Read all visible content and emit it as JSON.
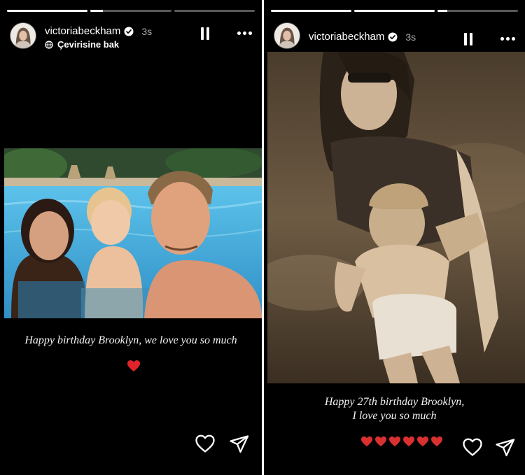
{
  "left_story": {
    "progress": [
      1,
      0.15,
      0
    ],
    "username": "victoriabeckham",
    "time": "3s",
    "translate_label": "Çevirisine bak",
    "caption": "Happy birthday Brooklyn, we love you so much",
    "icons": {
      "verified": "verified-badge-icon",
      "translate": "translate-icon",
      "pause": "pause-icon",
      "more": "more-icon",
      "like": "heart-outline-icon",
      "share": "send-icon",
      "emoji": "red-heart-emoji"
    },
    "heart_color": "#e0242b"
  },
  "right_story": {
    "progress": [
      1,
      1,
      0.12
    ],
    "username": "victoriabeckham",
    "time": "3s",
    "caption_line1": "Happy 27th birthday Brooklyn,",
    "caption_line2": "I love you so much",
    "hearts_count": 6,
    "icons": {
      "verified": "verified-badge-icon",
      "pause": "pause-icon",
      "more": "more-icon",
      "like": "heart-outline-icon",
      "share": "send-icon",
      "emoji": "red-heart-emoji"
    },
    "heart_color": "#d93030"
  }
}
